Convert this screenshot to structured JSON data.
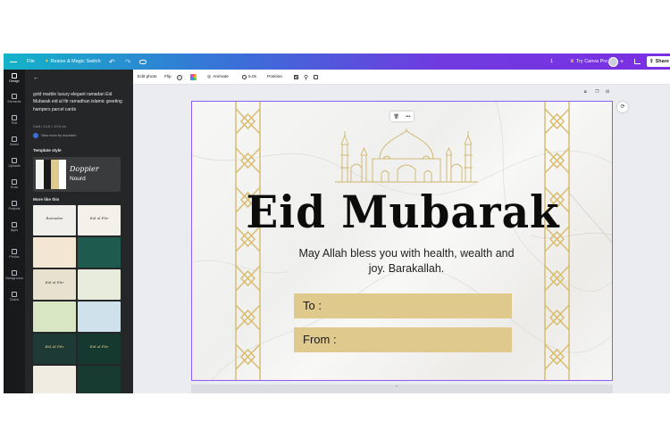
{
  "topbar": {
    "file": "File",
    "resize": "Resize & Magic Switch",
    "page_num": "1",
    "try_pro": "Try Canva Pro",
    "plus": "+",
    "share": "Share",
    "colors": {
      "gradient_start": "#13b3c9",
      "gradient_end": "#7b2fe3"
    }
  },
  "rail": [
    {
      "label": "Design",
      "icon": "design-icon"
    },
    {
      "label": "Elements",
      "icon": "elements-icon"
    },
    {
      "label": "Text",
      "icon": "text-icon"
    },
    {
      "label": "Brand",
      "icon": "brand-icon"
    },
    {
      "label": "Uploads",
      "icon": "uploads-icon"
    },
    {
      "label": "Draw",
      "icon": "draw-icon"
    },
    {
      "label": "Projects",
      "icon": "projects-icon"
    },
    {
      "label": "Apps",
      "icon": "apps-icon"
    },
    {
      "label": "Photos",
      "icon": "photos-icon"
    },
    {
      "label": "Background",
      "icon": "background-icon"
    },
    {
      "label": "Charts",
      "icon": "charts-icon"
    }
  ],
  "panel": {
    "template_title": "gold marble luxury elegant ramadan Eid Mubarak eid al fitr ramadhan islamic greeting hampers parcel cards",
    "subtitle": "Card • 14.8 × 10.5 cm",
    "author": "View more by moonkim",
    "template_style_heading": "Template style",
    "font_primary": "Doppier",
    "font_secondary": "Nourd",
    "swatches": [
      "#f2f2f0",
      "#1a1a1a",
      "#dfc98d",
      "#ffffff"
    ],
    "more_like_this": "More like this",
    "thumbnails": [
      {
        "text": "Ramadan",
        "bg": "#f1efe9"
      },
      {
        "text": "Eid al Fitr",
        "bg": "#f4f1ea"
      },
      {
        "text": "",
        "bg": "#f3e6d3"
      },
      {
        "text": "",
        "bg": "#1f5a4e"
      },
      {
        "text": "Eid al Fitr",
        "bg": "#e9e1cf"
      },
      {
        "text": "",
        "bg": "#e8ecdc"
      },
      {
        "text": "",
        "bg": "#d8e6c4"
      },
      {
        "text": "",
        "bg": "#cfe1ea"
      },
      {
        "text": "Eid Al Fitr",
        "bg": "#1d3a34"
      },
      {
        "text": "Eid al Fitr",
        "bg": "#15382f"
      },
      {
        "text": "",
        "bg": "#f0ece2"
      },
      {
        "text": "",
        "bg": "#173a31"
      }
    ]
  },
  "context_toolbar": {
    "edit_photo": "Edit photo",
    "flip": "Flip",
    "animate": "Animate",
    "duration": "5.0s",
    "position": "Position"
  },
  "card": {
    "title": "Eid Mubarak",
    "message": "May Allah bless you with health, wealth and joy. Barakallah.",
    "to_label": "To :",
    "from_label": "From :",
    "colors": {
      "gold": "#dfc98d",
      "frame": "#8b5cf6",
      "text": "#0c0c0c"
    }
  }
}
